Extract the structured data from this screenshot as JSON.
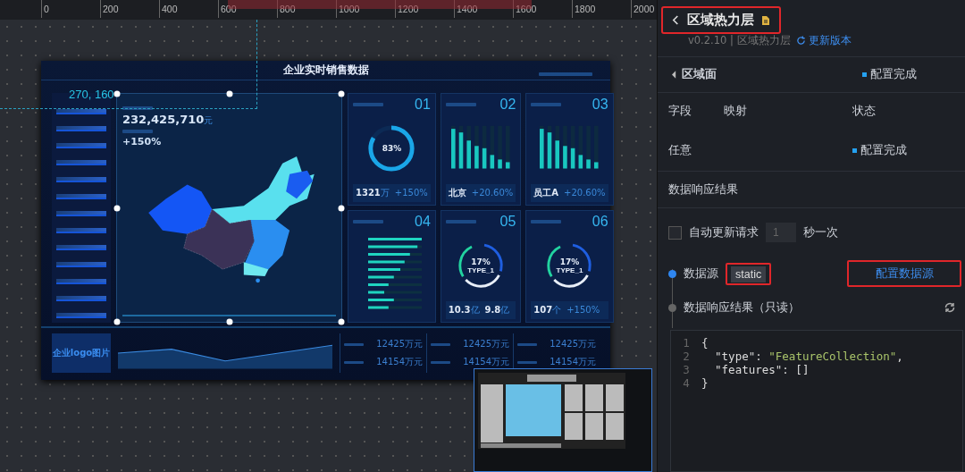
{
  "ruler": {
    "ticks": [
      "0",
      "200",
      "400",
      "600",
      "800",
      "1000",
      "1200",
      "1400",
      "1600",
      "1800",
      "2000"
    ]
  },
  "dashboard": {
    "title": "企业实时销售数据",
    "cursor_coords": "270, 160",
    "total": {
      "value": "232,425,710",
      "unit": "元",
      "change": "+150%"
    },
    "cards": [
      {
        "number": "01",
        "kind": "ring",
        "level": 0.83,
        "center": "83%",
        "stats": [
          {
            "value": "1321",
            "unit": "万",
            "kind": "number"
          },
          {
            "value": "+150%",
            "kind": "change"
          }
        ]
      },
      {
        "number": "02",
        "kind": "columns",
        "stats": [
          {
            "value": "北京",
            "kind": "number"
          },
          {
            "value": "+20.60%",
            "kind": "change"
          }
        ]
      },
      {
        "number": "03",
        "kind": "columns",
        "stats": [
          {
            "value": "员工A",
            "kind": "number"
          },
          {
            "value": "+20.60%",
            "kind": "change"
          }
        ]
      },
      {
        "number": "04",
        "kind": "hbars"
      },
      {
        "number": "05",
        "kind": "donut",
        "center": "17%",
        "sub": "TYPE_1",
        "stats": [
          {
            "value": "10.3",
            "unit": "亿",
            "kind": "number"
          },
          {
            "value": "9.8",
            "unit": "亿",
            "kind": "number"
          }
        ]
      },
      {
        "number": "06",
        "kind": "donut",
        "center": "17%",
        "sub": "TYPE_1",
        "stats": [
          {
            "value": "107",
            "unit": "个",
            "kind": "number"
          },
          {
            "value": "+150%",
            "kind": "change"
          }
        ]
      }
    ],
    "logo": "企业logo图片",
    "summaries": [
      {
        "values": [
          "12425万元",
          "14154万元"
        ]
      },
      {
        "values": [
          "12425万元",
          "14154万元"
        ]
      },
      {
        "values": [
          "12425万元",
          "14154万元"
        ]
      }
    ]
  },
  "panel": {
    "title": "区域热力层",
    "title_highlighted": true,
    "version": "v0.2.10 | 区域热力层",
    "update": "更新版本",
    "section": {
      "title": "区域面",
      "status": "配置完成"
    },
    "table": {
      "columns": [
        "字段",
        "映射",
        "状态"
      ],
      "rows": [
        {
          "field": "任意",
          "status": "配置完成"
        }
      ]
    },
    "result_heading": "数据响应结果",
    "auto_update": {
      "label": "自动更新请求",
      "checked": false,
      "interval": "1",
      "suffix": "秒一次"
    },
    "steps": [
      {
        "label": "数据源",
        "active": true,
        "value": "static",
        "value_highlighted": true
      },
      {
        "label": "数据响应结果（只读）",
        "active": false
      }
    ],
    "configure_button": {
      "label": "配置数据源",
      "highlighted": true
    },
    "code": {
      "lines": [
        {
          "number": "1",
          "tokens": [
            {
              "text": "{",
              "kind": "punct"
            }
          ]
        },
        {
          "number": "2",
          "tokens": [
            {
              "text": "  \"type\"",
              "kind": "key"
            },
            {
              "text": ": ",
              "kind": "punct"
            },
            {
              "text": "\"FeatureCollection\"",
              "kind": "string"
            },
            {
              "text": ",",
              "kind": "punct"
            }
          ]
        },
        {
          "number": "3",
          "tokens": [
            {
              "text": "  \"features\"",
              "kind": "key"
            },
            {
              "text": ": []",
              "kind": "punct"
            }
          ]
        },
        {
          "number": "4",
          "tokens": [
            {
              "text": "}",
              "kind": "punct"
            }
          ]
        }
      ]
    }
  }
}
